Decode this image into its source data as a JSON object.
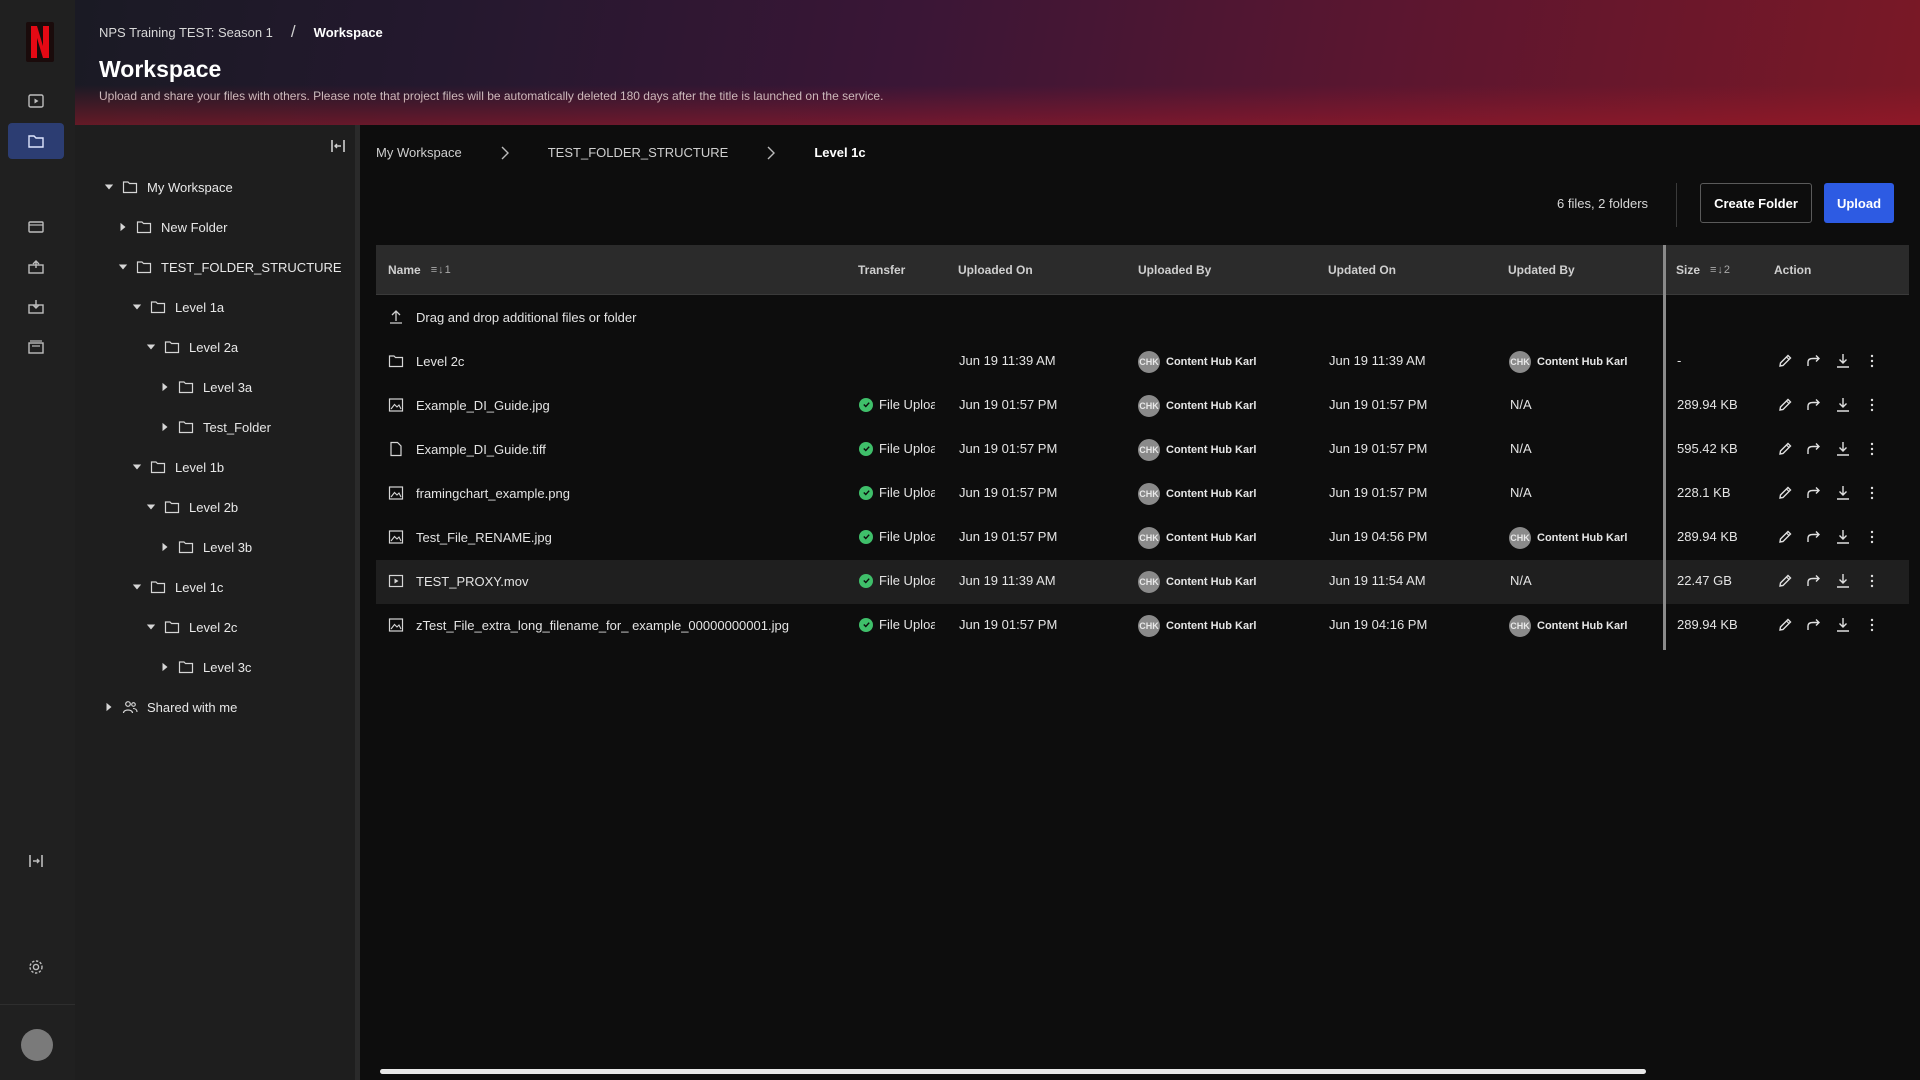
{
  "header": {
    "project": "NPS Training TEST: Season 1",
    "separator": "/",
    "current": "Workspace",
    "title": "Workspace",
    "subtitle": "Upload and share your files with others. Please note that project files will be automatically deleted 180 days after the title is launched on the service."
  },
  "rail": {
    "icons": [
      "netflix-logo",
      "play-icon",
      "folder-icon",
      "film-icon",
      "upload-box-icon",
      "download-box-icon",
      "archive-icon",
      "expand-icon",
      "gear-icon",
      "avatar"
    ]
  },
  "tree": {
    "items": [
      {
        "label": "My Workspace",
        "icon": "folder-icon",
        "caret": "down"
      },
      {
        "label": "New Folder",
        "icon": "folder-icon",
        "caret": "right"
      },
      {
        "label": "TEST_FOLDER_STRUCTURE",
        "icon": "folder-icon",
        "caret": "down"
      },
      {
        "label": "Level 1a",
        "icon": "folder-icon",
        "caret": "down"
      },
      {
        "label": "Level 2a",
        "icon": "folder-icon",
        "caret": "down"
      },
      {
        "label": "Level 3a",
        "icon": "folder-icon",
        "caret": "right"
      },
      {
        "label": "Test_Folder",
        "icon": "folder-icon",
        "caret": "right"
      },
      {
        "label": "Level 1b",
        "icon": "folder-icon",
        "caret": "down"
      },
      {
        "label": "Level 2b",
        "icon": "folder-icon",
        "caret": "down"
      },
      {
        "label": "Level 3b",
        "icon": "folder-icon",
        "caret": "right"
      },
      {
        "label": "Level 1c",
        "icon": "folder-icon",
        "caret": "down"
      },
      {
        "label": "Level 2c",
        "icon": "folder-icon",
        "caret": "down"
      },
      {
        "label": "Level 3c",
        "icon": "folder-icon",
        "caret": "right"
      },
      {
        "label": "Shared with me",
        "icon": "shared-users-icon",
        "caret": "right"
      }
    ]
  },
  "breadcrumb": [
    "My Workspace",
    "TEST_FOLDER_STRUCTURE",
    "Level 1c"
  ],
  "toolbar": {
    "counts": "6 files, 2 folders",
    "create_folder": "Create Folder",
    "upload": "Upload"
  },
  "table": {
    "columns": {
      "name": "Name",
      "name_sort": "≡↓1",
      "transfer": "Transfer",
      "uploaded_on": "Uploaded On",
      "uploaded_by": "Uploaded By",
      "updated_on": "Updated On",
      "updated_by": "Updated By",
      "size": "Size",
      "size_sort": "≡↓2",
      "action": "Action"
    },
    "dropzone": "Drag and drop additional files or folder",
    "rows": [
      {
        "name": "Level 2c",
        "icon": "folder-icon",
        "transfer": "",
        "uploaded_on": "Jun 19 11:39 AM",
        "uploaded_by": "Content Hub Karl",
        "uploaded_by_initials": "CHK",
        "updated_on": "Jun 19 11:39 AM",
        "updated_by": "Content Hub Karl",
        "updated_by_initials": "CHK",
        "size": "-"
      },
      {
        "name": "Example_DI_Guide.jpg",
        "icon": "image-icon",
        "transfer": "File Upload",
        "uploaded_on": "Jun 19 01:57 PM",
        "uploaded_by": "Content Hub Karl",
        "uploaded_by_initials": "CHK",
        "updated_on": "Jun 19 01:57 PM",
        "updated_by": "N/A",
        "updated_by_initials": "",
        "size": "289.94 KB"
      },
      {
        "name": "Example_DI_Guide.tiff",
        "icon": "document-icon",
        "transfer": "File Upload",
        "uploaded_on": "Jun 19 01:57 PM",
        "uploaded_by": "Content Hub Karl",
        "uploaded_by_initials": "CHK",
        "updated_on": "Jun 19 01:57 PM",
        "updated_by": "N/A",
        "updated_by_initials": "",
        "size": "595.42 KB"
      },
      {
        "name": "framingchart_example.png",
        "icon": "image-icon",
        "transfer": "File Upload",
        "uploaded_on": "Jun 19 01:57 PM",
        "uploaded_by": "Content Hub Karl",
        "uploaded_by_initials": "CHK",
        "updated_on": "Jun 19 01:57 PM",
        "updated_by": "N/A",
        "updated_by_initials": "",
        "size": "228.1 KB"
      },
      {
        "name": "Test_File_RENAME.jpg",
        "icon": "image-icon",
        "transfer": "File Upload",
        "uploaded_on": "Jun 19 01:57 PM",
        "uploaded_by": "Content Hub Karl",
        "uploaded_by_initials": "CHK",
        "updated_on": "Jun 19 04:56 PM",
        "updated_by": "Content Hub Karl",
        "updated_by_initials": "CHK",
        "size": "289.94 KB"
      },
      {
        "name": "TEST_PROXY.mov",
        "icon": "video-icon",
        "transfer": "File Upload",
        "uploaded_on": "Jun 19 11:39 AM",
        "uploaded_by": "Content Hub Karl",
        "uploaded_by_initials": "CHK",
        "updated_on": "Jun 19 11:54 AM",
        "updated_by": "N/A",
        "updated_by_initials": "",
        "size": "22.47 GB",
        "highlighted": true
      },
      {
        "name": "zTest_File_extra_long_filename_for_ example_00000000001.jpg",
        "icon": "image-icon",
        "transfer": "File Upload",
        "uploaded_on": "Jun 19 01:57 PM",
        "uploaded_by": "Content Hub Karl",
        "uploaded_by_initials": "CHK",
        "updated_on": "Jun 19 04:16 PM",
        "updated_by": "Content Hub Karl",
        "updated_by_initials": "CHK",
        "size": "289.94 KB"
      }
    ],
    "actions": [
      "edit-icon",
      "share-icon",
      "download-icon",
      "more-icon"
    ]
  },
  "colors": {
    "accent": "#2d5be3",
    "success": "#3fbf6a",
    "brand": "#e50914"
  }
}
